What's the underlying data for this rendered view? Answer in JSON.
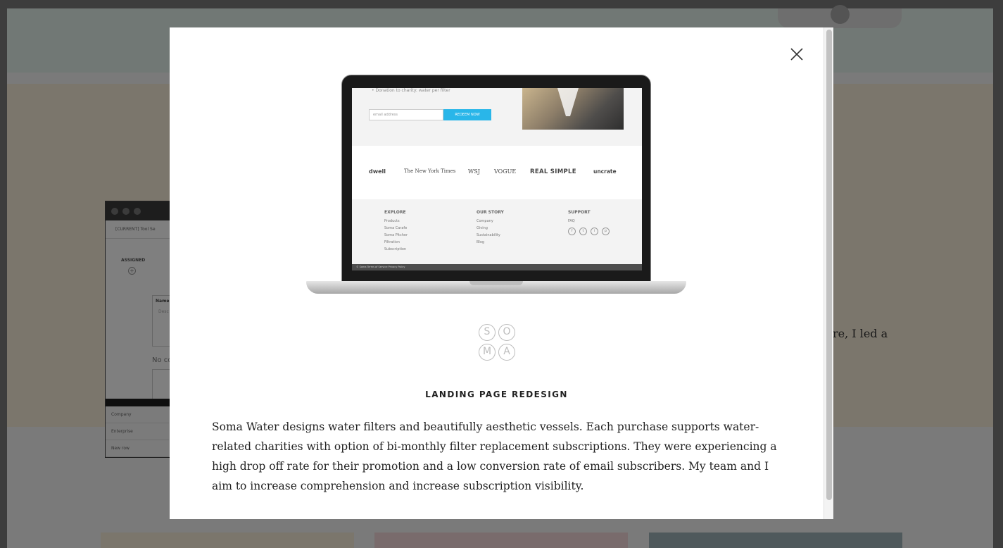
{
  "background": {
    "side_text": "re, I led a",
    "screenshot": {
      "crumb": "[CURRENT] Tool Se",
      "assigned": "ASSIGNED",
      "card_label": "Name",
      "card_placeholder": "Desc",
      "no_content": "No co",
      "rows": [
        "Company",
        "Enterprise",
        "New row"
      ]
    },
    "colors": {
      "top_band": "#e3f1ea",
      "mid_band": "#f6ecd8",
      "card_yellow": "#f6ecd8",
      "card_pink": "#f3d6d8",
      "card_slate": "#9fb2b8"
    }
  },
  "modal": {
    "close_icon": "close-icon",
    "title": "LANDING PAGE REDESIGN",
    "description": "Soma Water designs water filters and beautifully aesthetic vessels. Each purchase supports water-related charities with option of bi-monthly filter replacement subscriptions. They were experiencing a high drop off rate for their promotion and a low conversion rate of email subscribers. My team and I aim to increase comprehension and increase subscription visibility.",
    "logo_letters": [
      "S",
      "O",
      "M",
      "A"
    ],
    "laptop_screen": {
      "bullet_text": "• Donation to charity: water per filter",
      "email_placeholder": "email address",
      "redeem_label": "REDEEM NOW",
      "press_logos": [
        "dwell",
        "The New York Times",
        "WSJ",
        "VOGUE",
        "REAL SIMPLE",
        "uncrate"
      ],
      "footer": {
        "explore": {
          "heading": "EXPLORE",
          "links": [
            "Products",
            "Soma Carafe",
            "Soma Pitcher",
            "Filtration",
            "Subscription"
          ]
        },
        "story": {
          "heading": "OUR STORY",
          "links": [
            "Company",
            "Giving",
            "Sustainability",
            "Blog"
          ]
        },
        "support": {
          "heading": "SUPPORT",
          "links": [
            "FAQ"
          ],
          "social": [
            "f",
            "t",
            "i",
            "p"
          ]
        }
      },
      "legal": "© Soma    Terms of Service    Privacy Policy"
    }
  }
}
